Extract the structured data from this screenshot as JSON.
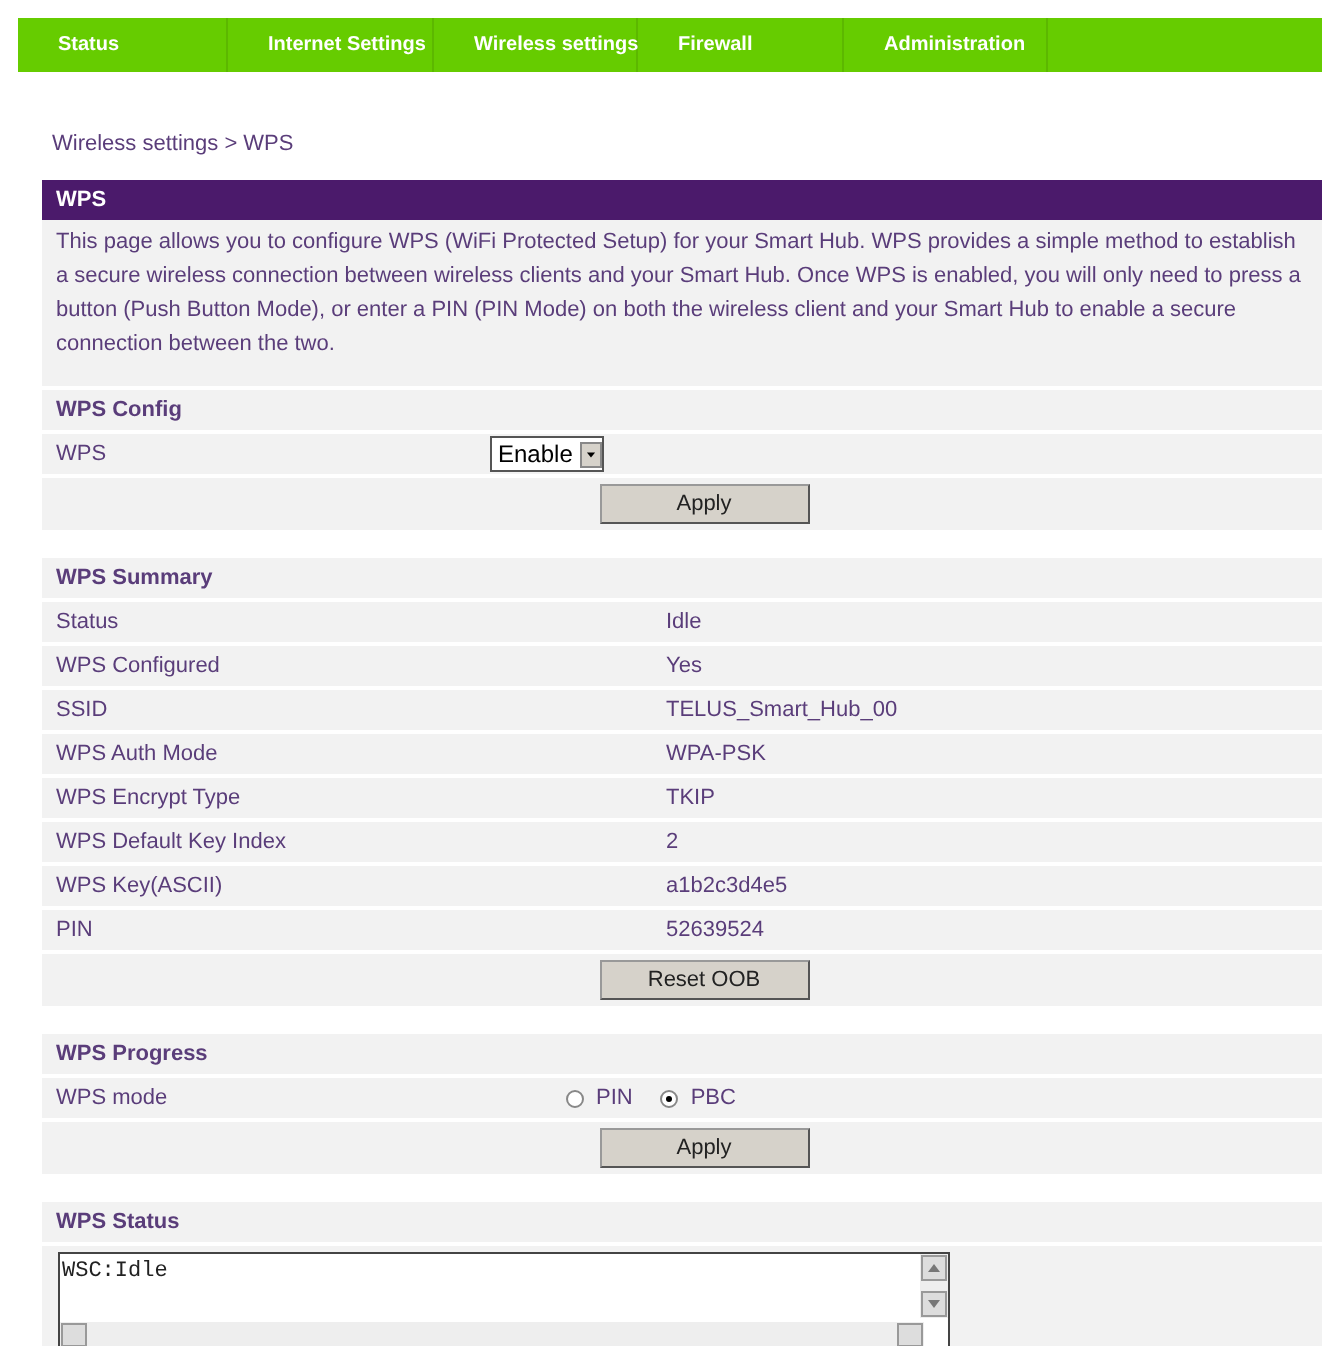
{
  "nav": [
    {
      "label": "Status"
    },
    {
      "label": "Internet Settings"
    },
    {
      "label": "Wireless settings"
    },
    {
      "label": "Firewall"
    },
    {
      "label": "Administration"
    }
  ],
  "breadcrumb": "Wireless settings > WPS",
  "page": {
    "title": "WPS",
    "description": "This page allows you to configure WPS (WiFi Protected Setup) for your Smart Hub. WPS provides a simple method to establish a secure wireless connection between wireless clients and your Smart Hub. Once WPS is enabled, you will only need to press a button (Push Button Mode), or enter a PIN (PIN Mode) on both the wireless client and your Smart Hub to enable a secure connection between the two."
  },
  "wps_config": {
    "title": "WPS Config",
    "label": "WPS",
    "select_value": "Enable",
    "button": "Apply"
  },
  "wps_summary": {
    "title": "WPS Summary",
    "rows": [
      {
        "label": "Status",
        "value": "Idle"
      },
      {
        "label": "WPS Configured",
        "value": "Yes"
      },
      {
        "label": "SSID",
        "value": "TELUS_Smart_Hub_00"
      },
      {
        "label": "WPS Auth Mode",
        "value": "WPA-PSK"
      },
      {
        "label": "WPS Encrypt Type",
        "value": "TKIP"
      },
      {
        "label": "WPS Default Key Index",
        "value": "2"
      },
      {
        "label": "WPS Key(ASCII)",
        "value": "a1b2c3d4e5"
      },
      {
        "label": "PIN",
        "value": "52639524"
      }
    ],
    "button": "Reset OOB"
  },
  "wps_progress": {
    "title": "WPS Progress",
    "label": "WPS mode",
    "options": [
      {
        "label": "PIN",
        "selected": false
      },
      {
        "label": "PBC",
        "selected": true
      }
    ],
    "button": "Apply"
  },
  "wps_status": {
    "title": "WPS Status",
    "log": "WSC:Idle"
  }
}
